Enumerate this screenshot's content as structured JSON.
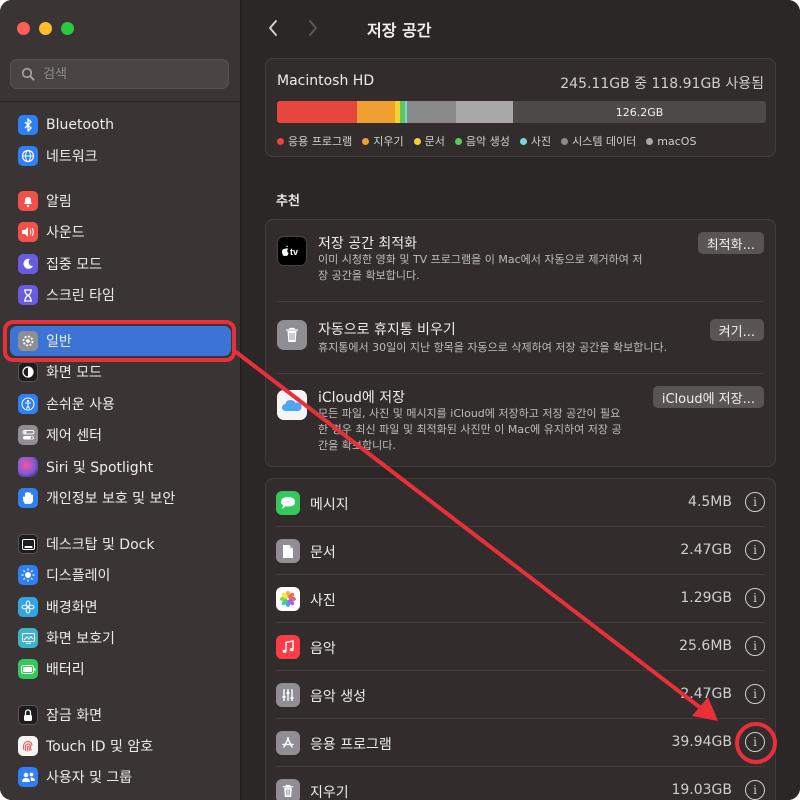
{
  "window": {
    "traffic_lights": [
      "#ff5f57",
      "#febc2e",
      "#28c840"
    ]
  },
  "sidebar": {
    "search": {
      "placeholder": "검색"
    },
    "items": [
      {
        "label": "Bluetooth",
        "icon": "bluetooth-icon",
        "color": "#2f7ff5"
      },
      {
        "label": "네트워크",
        "icon": "network-icon",
        "color": "#2f7ff5"
      },
      {
        "label": "알림",
        "icon": "bell-icon",
        "color": "#f2514a"
      },
      {
        "label": "사운드",
        "icon": "speaker-icon",
        "color": "#f2514a"
      },
      {
        "label": "집중 모드",
        "icon": "moon-icon",
        "color": "#6a5ce0"
      },
      {
        "label": "스크린 타임",
        "icon": "hourglass-icon",
        "color": "#6a5ce0"
      },
      {
        "label": "일반",
        "icon": "gear-icon",
        "color": "#8e8e93"
      },
      {
        "label": "화면 모드",
        "icon": "appearance-icon",
        "color": "#1c1c1e"
      },
      {
        "label": "손쉬운 사용",
        "icon": "accessibility-icon",
        "color": "#2f7ff5"
      },
      {
        "label": "제어 센터",
        "icon": "control-center-icon",
        "color": "#8e8e93"
      },
      {
        "label": "Siri 및 Spotlight",
        "icon": "siri-icon",
        "color": "#7b5cd6"
      },
      {
        "label": "개인정보 보호 및 보안",
        "icon": "hand-icon",
        "color": "#2f7ff5"
      },
      {
        "label": "데스크탑 및 Dock",
        "icon": "dock-icon",
        "color": "#1c1c1e"
      },
      {
        "label": "디스플레이",
        "icon": "sun-icon",
        "color": "#2f7ff5"
      },
      {
        "label": "배경화면",
        "icon": "wallpaper-icon",
        "color": "#35a4e6"
      },
      {
        "label": "화면 보호기",
        "icon": "screensaver-icon",
        "color": "#3bb6c9"
      },
      {
        "label": "배터리",
        "icon": "battery-icon",
        "color": "#34c759"
      },
      {
        "label": "잠금 화면",
        "icon": "lock-icon",
        "color": "#1c1c1e"
      },
      {
        "label": "Touch ID 및 암호",
        "icon": "fingerprint-icon",
        "color": "#f5f5f5"
      },
      {
        "label": "사용자 및 그룹",
        "icon": "users-icon",
        "color": "#2f7ff5"
      }
    ],
    "selected": "일반"
  },
  "header": {
    "title": "저장 공간"
  },
  "disk": {
    "name": "Macintosh HD",
    "usage": "245.11GB 중 118.91GB 사용됨",
    "free_label": "126.2GB",
    "legend": [
      {
        "label": "응용 프로그램",
        "color": "#e8453c"
      },
      {
        "label": "지우기",
        "color": "#f0a030"
      },
      {
        "label": "문서",
        "color": "#f5d033"
      },
      {
        "label": "음악 생성",
        "color": "#5ac85a"
      },
      {
        "label": "사진",
        "color": "#7ad3e0"
      },
      {
        "label": "시스템 데이터",
        "color": "#8a8a8a"
      },
      {
        "label": "macOS",
        "color": "#a8a8a8"
      }
    ],
    "segments": [
      {
        "name": "apps",
        "fraction": 0.163,
        "color": "#e8453c"
      },
      {
        "name": "trash",
        "fraction": 0.078,
        "color": "#f0a030"
      },
      {
        "name": "documents",
        "fraction": 0.01,
        "color": "#f5d033"
      },
      {
        "name": "music-creation",
        "fraction": 0.01,
        "color": "#5ac85a"
      },
      {
        "name": "photos",
        "fraction": 0.005,
        "color": "#7ad3e0"
      },
      {
        "name": "system-data",
        "fraction": 0.1,
        "color": "#8a8a8a"
      },
      {
        "name": "macos",
        "fraction": 0.117,
        "color": "#a8a8a8"
      }
    ]
  },
  "recommendations": {
    "section_title": "추천",
    "items": [
      {
        "title": "저장 공간 최적화",
        "desc": "이미 시청한 영화 및 TV 프로그램을 이 Mac에서 자동으로 제거하여 저장 공간을 확보합니다.",
        "button": "최적화...",
        "icon": "tv-icon"
      },
      {
        "title": "자동으로 휴지통 비우기",
        "desc": "휴지통에서 30일이 지난 항목을 자동으로 삭제하여 저장 공간을 확보합니다.",
        "button": "켜기...",
        "icon": "trash-icon"
      },
      {
        "title": "iCloud에 저장",
        "desc": "모든 파일, 사진 및 메시지를 iCloud에 저장하고 저장 공간이 필요한 경우 최신 파일 및 최적화된 사진만 이 Mac에 유지하여 저장 공간을 확보합니다.",
        "button": "iCloud에 저장...",
        "icon": "icloud-icon"
      }
    ]
  },
  "categories": [
    {
      "label": "메시지",
      "size": "4.5MB",
      "icon": "messages-icon",
      "color": "#34c759"
    },
    {
      "label": "문서",
      "size": "2.47GB",
      "icon": "document-icon",
      "color": "#8e8e93"
    },
    {
      "label": "사진",
      "size": "1.29GB",
      "icon": "photos-icon",
      "color": "#ffffff"
    },
    {
      "label": "음악",
      "size": "25.6MB",
      "icon": "music-icon",
      "color": "#fc3c44"
    },
    {
      "label": "음악 생성",
      "size": "2.47GB",
      "icon": "music-creation-icon",
      "color": "#8e8e93"
    },
    {
      "label": "응용 프로그램",
      "size": "39.94GB",
      "icon": "app-store-icon",
      "color": "#8e8e93"
    },
    {
      "label": "지우기",
      "size": "19.03GB",
      "icon": "trash-icon",
      "color": "#8e8e93"
    }
  ],
  "annotation": {
    "color": "#e8303a"
  }
}
